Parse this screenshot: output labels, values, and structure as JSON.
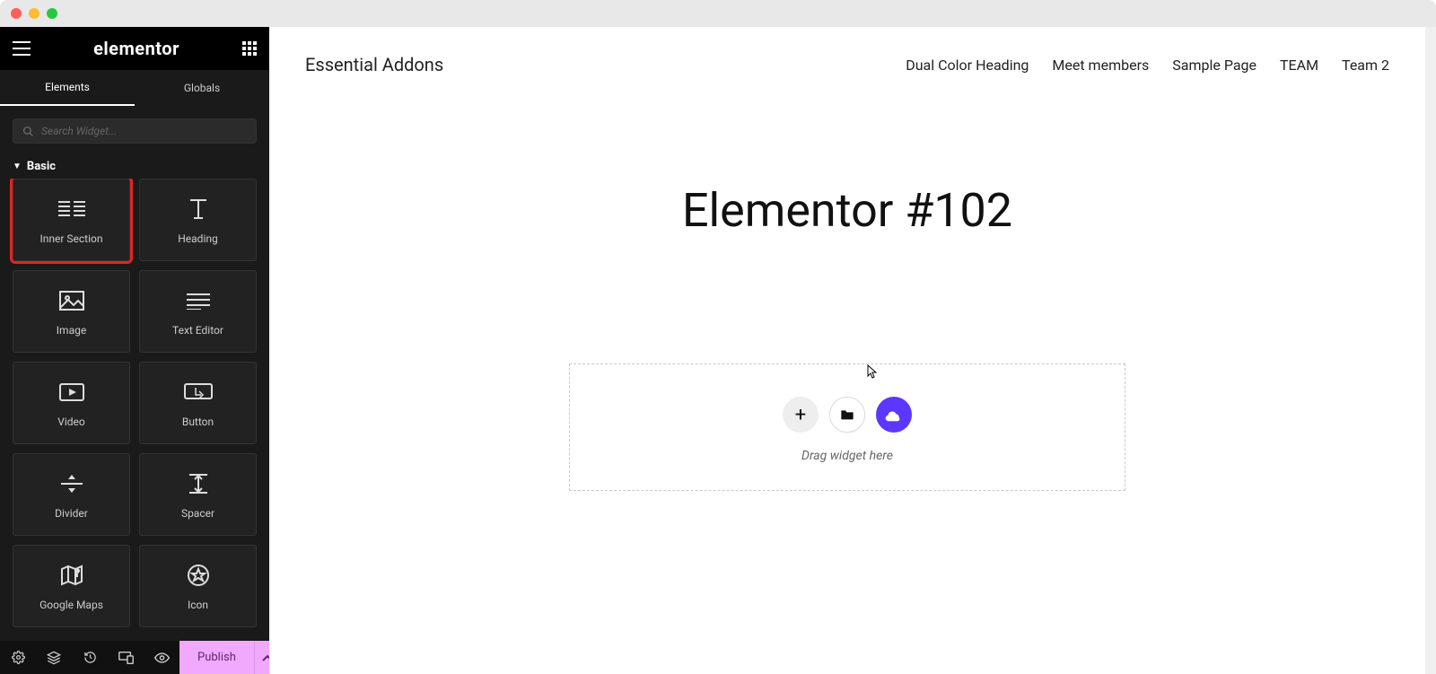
{
  "panel": {
    "brand": "elementor",
    "tabs": {
      "elements": "Elements",
      "globals": "Globals"
    },
    "search_placeholder": "Search Widget...",
    "category": "Basic",
    "widgets": [
      {
        "id": "inner-section",
        "label": "Inner Section"
      },
      {
        "id": "heading",
        "label": "Heading"
      },
      {
        "id": "image",
        "label": "Image"
      },
      {
        "id": "text-editor",
        "label": "Text Editor"
      },
      {
        "id": "video",
        "label": "Video"
      },
      {
        "id": "button",
        "label": "Button"
      },
      {
        "id": "divider",
        "label": "Divider"
      },
      {
        "id": "spacer",
        "label": "Spacer"
      },
      {
        "id": "google-maps",
        "label": "Google Maps"
      },
      {
        "id": "icon",
        "label": "Icon"
      }
    ],
    "publish_label": "Publish"
  },
  "preview": {
    "site_title": "Essential Addons",
    "menu": [
      "Dual Color Heading",
      "Meet members",
      "Sample Page",
      "TEAM",
      "Team 2"
    ],
    "page_title": "Elementor #102",
    "drop_hint": "Drag widget here"
  },
  "highlight_widget_id": "inner-section",
  "colors": {
    "accent": "#5d36ff",
    "publish": "#f1a8ff",
    "highlight": "#e02424"
  }
}
